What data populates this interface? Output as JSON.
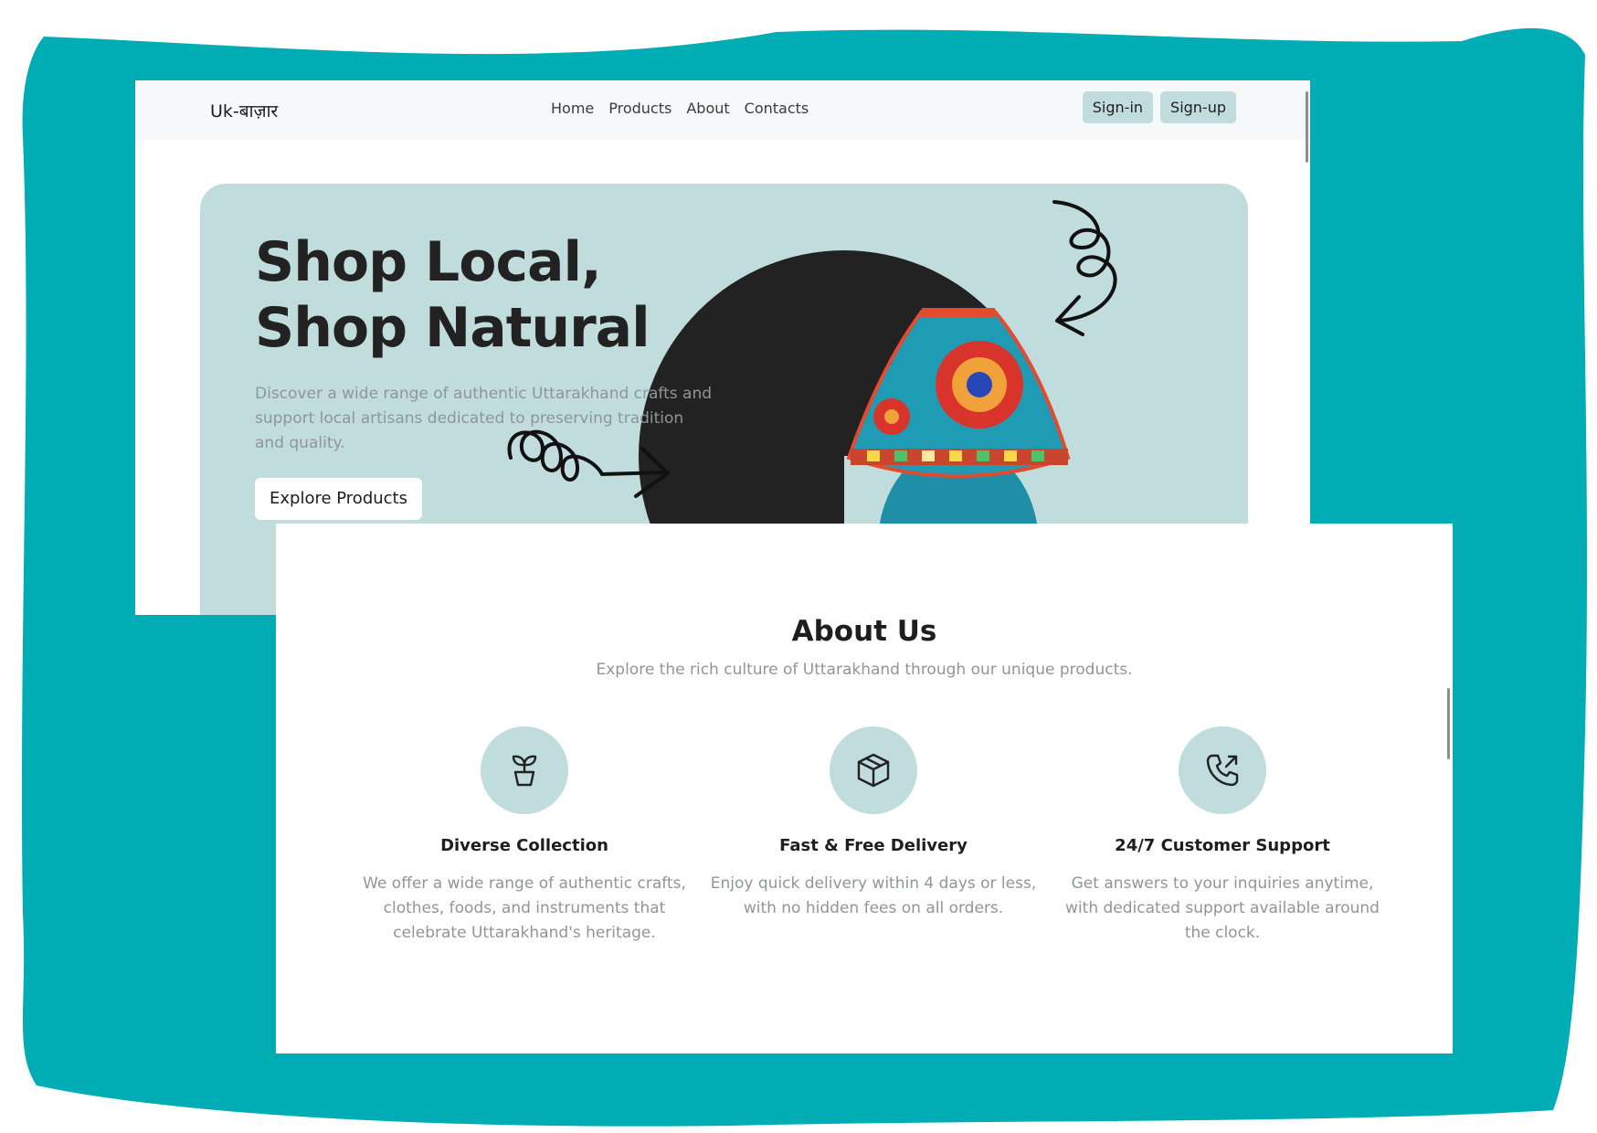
{
  "colors": {
    "teal_backdrop": "#00adb5",
    "hero_bg": "#c1dcdc",
    "navbar_bg": "#f7f8f9",
    "text_dark": "#222222",
    "text_muted": "#8f9696"
  },
  "navbar": {
    "brand": "Uk-बाज़ार",
    "links": [
      "Home",
      "Products",
      "About",
      "Contacts"
    ],
    "signin_label": "Sign-in",
    "signup_label": "Sign-up"
  },
  "hero": {
    "title_line1": "Shop Local,",
    "title_line2": "Shop Natural",
    "description": "Discover a wide range of authentic Uttarakhand crafts and support local artisans dedicated to preserving tradition and quality.",
    "cta_label": "Explore Products",
    "image": "mosaic-lamp-image"
  },
  "about": {
    "title": "About Us",
    "subtitle": "Explore the rich culture of Uttarakhand through our unique products.",
    "features": [
      {
        "icon": "plant-pot-icon",
        "title": "Diverse Collection",
        "description": "We offer a wide range of authentic crafts, clothes, foods, and instruments that celebrate Uttarakhand's heritage."
      },
      {
        "icon": "box-icon",
        "title": "Fast & Free Delivery",
        "description": "Enjoy quick delivery within 4 days or less, with no hidden fees on all orders."
      },
      {
        "icon": "phone-outgoing-icon",
        "title": "24/7 Customer Support",
        "description": "Get answers to your inquiries anytime, with dedicated support available around the clock."
      }
    ]
  }
}
